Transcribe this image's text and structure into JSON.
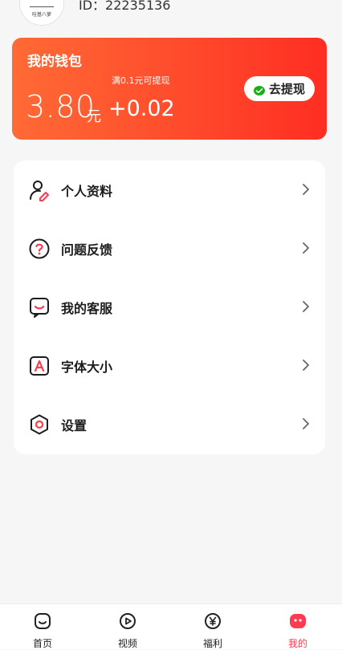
{
  "profile": {
    "avatar_text": "哇基八萝",
    "id_label": "ID：22235136"
  },
  "wallet": {
    "title": "我的钱包",
    "hint": "满0.1元可提现",
    "amount": "3.80",
    "unit": "元",
    "delta": "+0.02",
    "withdraw_label": "去提现",
    "withdraw_icon": "wechat-icon"
  },
  "menu": {
    "items": [
      {
        "label": "个人资料",
        "icon": "profile-edit-icon"
      },
      {
        "label": "问题反馈",
        "icon": "question-icon"
      },
      {
        "label": "我的客服",
        "icon": "customer-service-icon"
      },
      {
        "label": "字体大小",
        "icon": "font-size-icon"
      },
      {
        "label": "设置",
        "icon": "settings-icon"
      }
    ]
  },
  "bottom_nav": {
    "items": [
      {
        "label": "首页",
        "icon": "home-icon",
        "active": false
      },
      {
        "label": "视频",
        "icon": "video-icon",
        "active": false
      },
      {
        "label": "福利",
        "icon": "welfare-yen-icon",
        "active": false
      },
      {
        "label": "我的",
        "icon": "me-icon",
        "active": true
      }
    ]
  },
  "colors": {
    "accent": "#ff3b4f",
    "wallet_gradient_start": "#ff6a35",
    "wallet_gradient_end": "#ff2e22",
    "wechat_green": "#1aad19"
  }
}
